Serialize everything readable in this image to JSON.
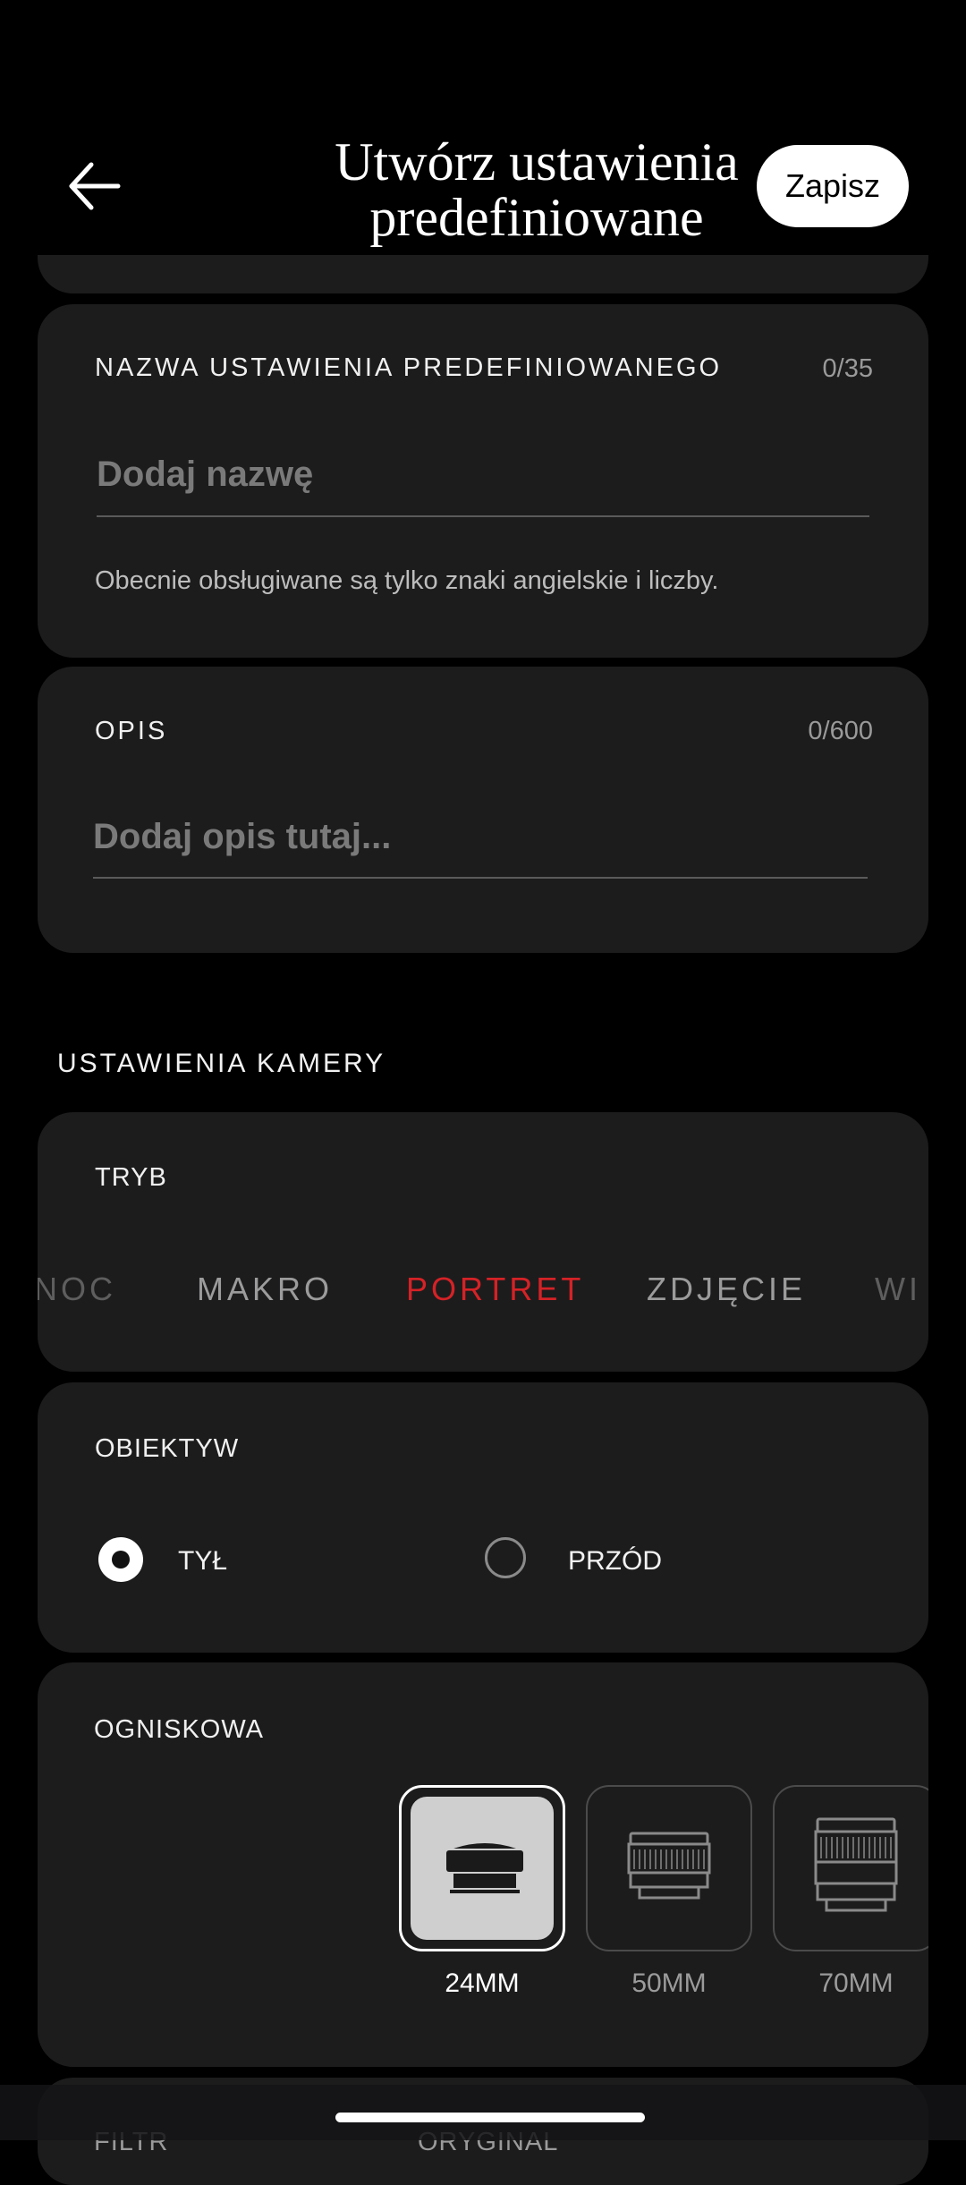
{
  "header": {
    "title_line1": "Utwórz ustawienia",
    "title_line2": "predefiniowane",
    "save_label": "Zapisz"
  },
  "name_card": {
    "label": "NAZWA USTAWIENIA PREDEFINIOWANEGO",
    "counter": "0/35",
    "placeholder": "Dodaj nazwę",
    "helper": "Obecnie obsługiwane są tylko znaki angielskie i liczby."
  },
  "desc_card": {
    "label": "OPIS",
    "counter": "0/600",
    "placeholder": "Dodaj opis tutaj..."
  },
  "camera_settings": {
    "title": "USTAWIENIA KAMERY",
    "mode": {
      "label": "TRYB",
      "options": [
        "NOC",
        "MAKRO",
        "PORTRET",
        "ZDJĘCIE",
        "WI"
      ],
      "selected": "PORTRET"
    },
    "lens": {
      "label": "OBIEKTYW",
      "options": [
        "TYŁ",
        "PRZÓD"
      ],
      "selected": "TYŁ"
    },
    "focal": {
      "label": "OGNISKOWA",
      "options": [
        "24MM",
        "50MM",
        "70MM"
      ],
      "selected": "24MM"
    },
    "filter": {
      "label": "FILTR",
      "value": "ORYGINAL"
    }
  },
  "colors": {
    "accent": "#d52226",
    "card_bg": "#1c1c1d",
    "background": "#000000"
  }
}
